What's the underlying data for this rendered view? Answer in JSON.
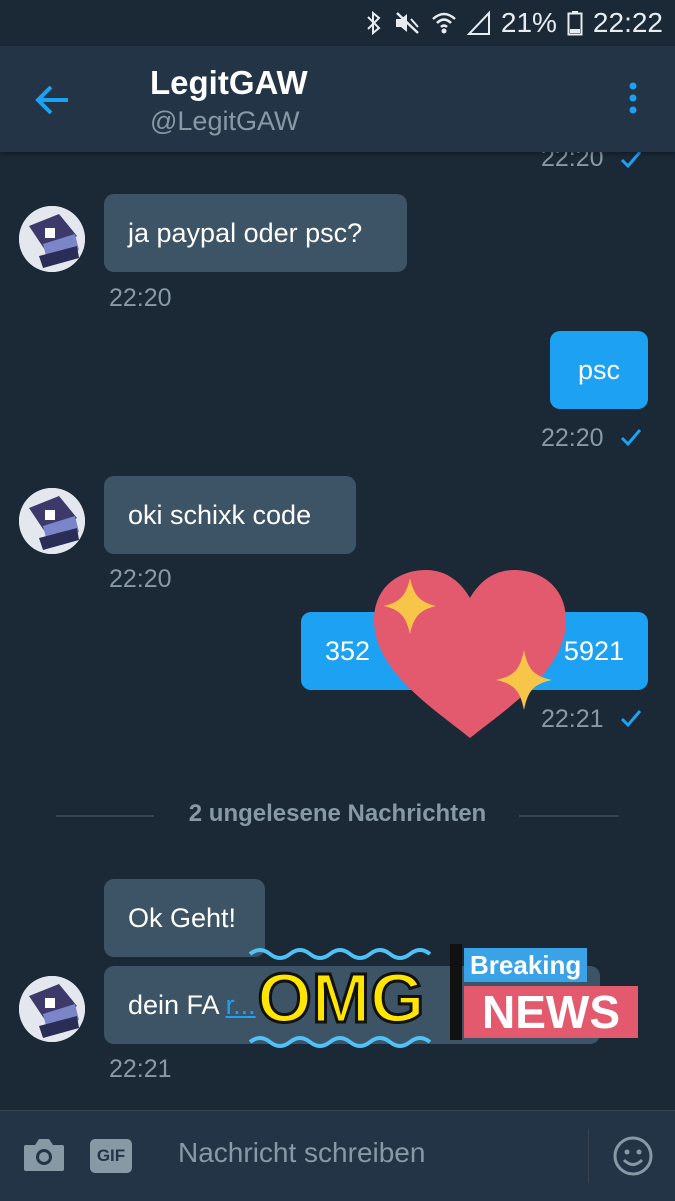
{
  "status": {
    "battery": "21%",
    "time": "22:22"
  },
  "header": {
    "title": "LegitGAW",
    "handle": "@LegitGAW"
  },
  "messages": {
    "top_time": "22:20",
    "m1": {
      "text": "ja paypal oder psc?",
      "time": "22:20"
    },
    "m2": {
      "text": "psc",
      "time": "22:20"
    },
    "m3": {
      "text": "oki schixk code",
      "time": "22:20"
    },
    "m4": {
      "text_left": "352",
      "text_right": "5921",
      "time": "22:21"
    },
    "unread_label": "2 ungelesene Nachrichten",
    "m5": {
      "text": "Ok Geht!"
    },
    "m6": {
      "prefix": "dein FA ",
      "link": "r...",
      "time": "22:21"
    }
  },
  "stickers": {
    "omg": "OMG",
    "breaking": "Breaking",
    "news": "NEWS"
  },
  "composer": {
    "placeholder": "Nachricht schreiben",
    "gif": "GIF"
  },
  "colors": {
    "background": "#1b2836",
    "header": "#243447",
    "incoming": "#3d5466",
    "outgoing": "#1da1f2",
    "muted": "#8899a6"
  }
}
